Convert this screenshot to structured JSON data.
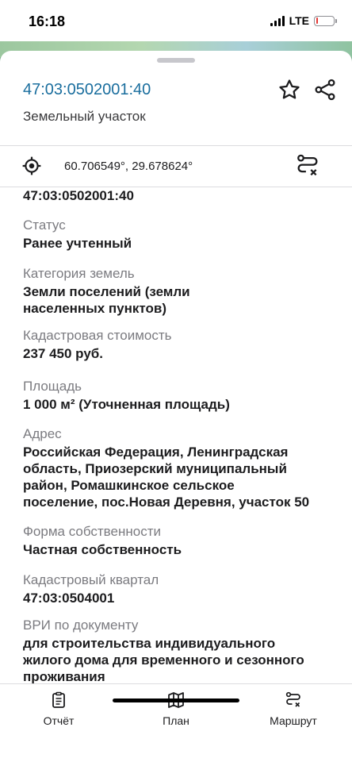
{
  "status_bar": {
    "time": "16:18",
    "network": "LTE",
    "battery_level": 0.1,
    "battery_color": "#e53935"
  },
  "header": {
    "cadastral_number": "47:03:0502001:40",
    "object_type": "Земельный участок",
    "star_icon": "star-outline-icon",
    "share_icon": "share-icon",
    "accent_color": "#1a6e9e"
  },
  "location": {
    "coordinates": "60.706549°, 29.678624°",
    "locate_icon": "target-icon",
    "route_icon": "route-clear-icon"
  },
  "details": {
    "top_value": "47:03:0502001:40",
    "fields": [
      {
        "label": "Статус",
        "value_lines": [
          "Ранее учтенный"
        ]
      },
      {
        "label": "Категория земель",
        "value_lines": [
          "Земли поселений (земли",
          "населенных пунктов)"
        ]
      },
      {
        "label": "Кадастровая стоимость",
        "value_lines": [
          "237 450 руб."
        ]
      },
      {
        "label": "Площадь",
        "value_lines": [
          "1 000 м² (Уточненная площадь)"
        ]
      },
      {
        "label": "Адрес",
        "value_lines": [
          "Российская Федерация, Ленинградская",
          "область, Приозерский муниципальный",
          "район, Ромашкинское сельское",
          "поселение, пос.Новая Деревня, участок 50"
        ]
      },
      {
        "label": "Форма собственности",
        "value_lines": [
          "Частная собственность"
        ]
      },
      {
        "label": "Кадастровый квартал",
        "value_lines": [
          "47:03:0504001"
        ]
      },
      {
        "label": "ВРИ по документу",
        "value_lines": [
          "для строительства индивидуального",
          "жилого дома для временного и сезонного",
          "проживания"
        ]
      }
    ]
  },
  "tabs": [
    {
      "label": "Отчёт",
      "icon": "report-clipboard-icon"
    },
    {
      "label": "План",
      "icon": "map-plan-icon"
    },
    {
      "label": "Маршрут",
      "icon": "route-icon"
    }
  ]
}
